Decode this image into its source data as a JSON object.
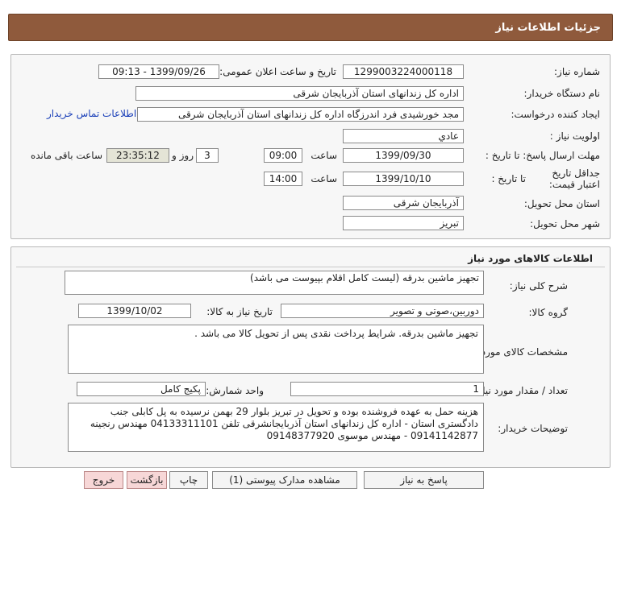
{
  "header": {
    "title": "جزئیات اطلاعات نیاز"
  },
  "details": {
    "need_number_label": "شماره نیاز:",
    "need_number": "1299003224000118",
    "announce_label": "تاریخ و ساعت اعلان عمومی:",
    "announce_value": "1399/09/26 - 09:13",
    "buyer_org_label": "نام دستگاه خریدار:",
    "buyer_org": "اداره کل زندانهای استان آذربایجان شرقی",
    "requester_label": "ایجاد کننده درخواست:",
    "requester": "مجد خورشیدی فرد اندرزگاه اداره کل زندانهای استان آذربایجان شرقی",
    "contact_link": "اطلاعات تماس خریدار",
    "priority_label": "اولویت نیاز :",
    "priority": "عادي",
    "reply_deadline_label": "مهلت ارسال پاسخ:",
    "to_date_label": "تا تاریخ :",
    "reply_date": "1399/09/30",
    "time_label": "ساعت",
    "reply_time": "09:00",
    "days": "3",
    "days_label": "روز و",
    "remaining": "23:35:12",
    "remaining_label": "ساعت باقی مانده",
    "price_validity_label": "جداقل تاریخ اعتبار قیمت:",
    "validity_to_label": "تا تاریخ :",
    "validity_date": "1399/10/10",
    "validity_time_label": "ساعت",
    "validity_time": "14:00",
    "province_label": "استان محل تحویل:",
    "province": "آذربایجان شرقی",
    "city_label": "شهر محل تحویل:",
    "city": "تبریز"
  },
  "goods": {
    "title": "اطلاعات کالاهای مورد نیاز",
    "summary_label": "شرح کلی نیاز:",
    "summary": "تجهیز ماشین بدرقه (لیست کامل اقلام بپیوست می باشد)",
    "group_label": "گروه کالا:",
    "group": "دوربین،صوتی و تصویر",
    "need_date_label": "تاریخ نیاز به کالا:",
    "need_date": "1399/10/02",
    "specs_label": "مشخصات کالای مورد نیاز:",
    "specs": "تجهیز ماشین بدرقه. شرایط پرداخت نقدی پس از تحویل کالا می باشد .",
    "qty_label": "تعداد / مقدار مورد نیاز:",
    "qty": "1",
    "unit_label": "واحد شمارش:",
    "unit": "پکیج کامل",
    "buyer_notes_label": "توضیحات خریدار:",
    "buyer_notes": "هزینه حمل به عهده فروشنده بوده و تحویل در تبریز بلوار 29 بهمن نرسیده به پل کابلی جنب دادگستری استان - اداره کل زندانهای استان آذربایجانشرقی تلفن 04133311101  مهندس رنجینه 09141142877 - مهندس موسوی 09148377920"
  },
  "buttons": {
    "reply": "پاسخ به نیاز",
    "view_docs": "مشاهده مدارک پیوستی (1)",
    "print": "چاپ",
    "back": "بازگشت",
    "exit": "خروج"
  }
}
